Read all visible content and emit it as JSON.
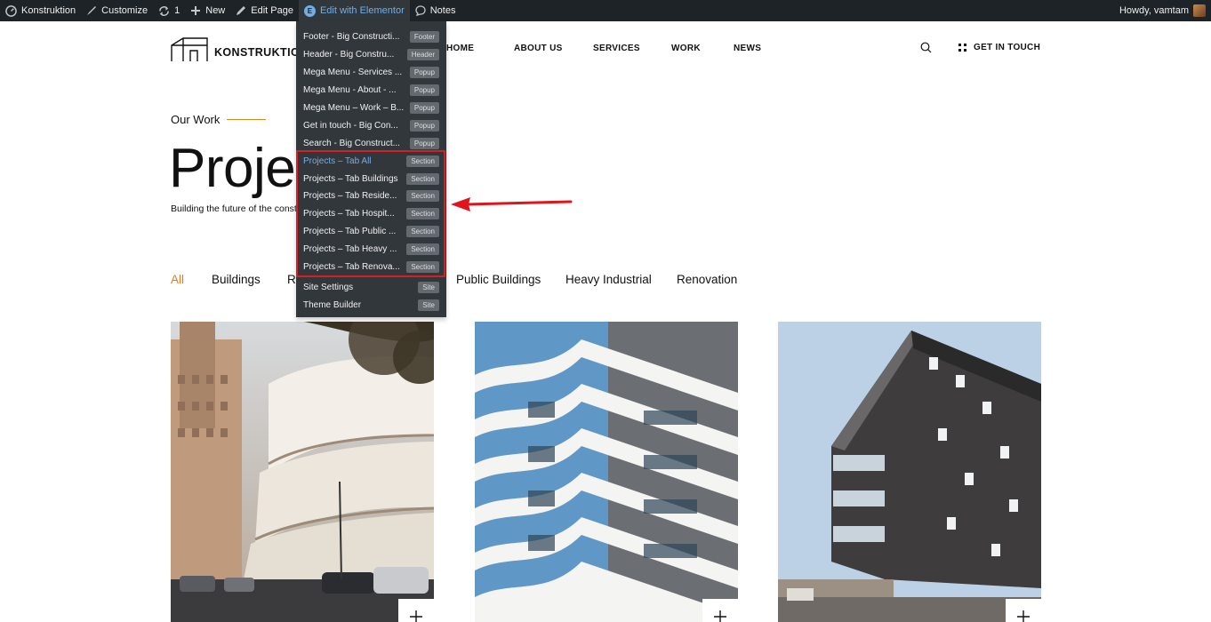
{
  "adminbar": {
    "site_name": "Konstruktion",
    "customize": "Customize",
    "updates_count": "1",
    "new": "New",
    "edit_page": "Edit Page",
    "edit_elementor": "Edit with Elementor",
    "notes": "Notes",
    "howdy": "Howdy, vamtam"
  },
  "header": {
    "logo_text": "KONSTRUKTIO",
    "nav": [
      "HOME",
      "ABOUT US",
      "SERVICES",
      "WORK",
      "NEWS"
    ],
    "cta": "GET IN TOUCH"
  },
  "hero": {
    "eyebrow": "Our Work",
    "title": "Projec",
    "subtitle": "Building the future of the const"
  },
  "tabs": [
    {
      "label": "All",
      "active": true
    },
    {
      "label": "Buildings"
    },
    {
      "label": "R"
    },
    {
      "label": "Public Buildings"
    },
    {
      "label": "Heavy Industrial"
    },
    {
      "label": "Renovation"
    }
  ],
  "elementor_menu": {
    "items": [
      {
        "label": "Footer - Big Constructi...",
        "badge": "Footer"
      },
      {
        "label": "Header - Big Constru...",
        "badge": "Header"
      },
      {
        "label": "Mega Menu - Services ...",
        "badge": "Popup"
      },
      {
        "label": "Mega Menu - About - ...",
        "badge": "Popup"
      },
      {
        "label": "Mega Menu – Work – B...",
        "badge": "Popup"
      },
      {
        "label": "Get in touch - Big Con...",
        "badge": "Popup"
      },
      {
        "label": "Search - Big Construct...",
        "badge": "Popup"
      },
      {
        "label": "Projects – Tab All",
        "badge": "Section",
        "current": true
      },
      {
        "label": "Projects – Tab Buildings",
        "badge": "Section"
      },
      {
        "label": "Projects – Tab Reside...",
        "badge": "Section"
      },
      {
        "label": "Projects – Tab Hospit...",
        "badge": "Section"
      },
      {
        "label": "Projects – Tab Public ...",
        "badge": "Section"
      },
      {
        "label": "Projects – Tab Heavy ...",
        "badge": "Section"
      },
      {
        "label": "Projects – Tab Renova...",
        "badge": "Section"
      }
    ],
    "footer_items": [
      {
        "label": "Site Settings",
        "badge": "Site"
      },
      {
        "label": "Theme Builder",
        "badge": "Site"
      }
    ]
  },
  "colors": {
    "accent": "#e8791e",
    "admin_bar": "#1d2327",
    "dropdown": "#32373c",
    "highlight": "#d41f26"
  }
}
